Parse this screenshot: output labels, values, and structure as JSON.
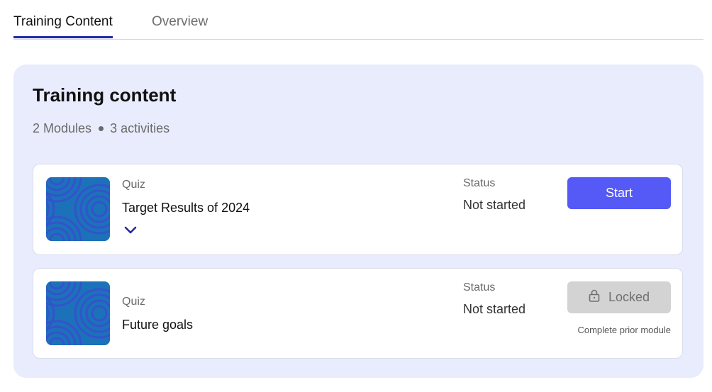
{
  "tabs": [
    {
      "label": "Training Content",
      "active": true
    },
    {
      "label": "Overview",
      "active": false
    }
  ],
  "panel": {
    "title": "Training content",
    "modules": "2 Modules",
    "activities": "3 activities"
  },
  "items": [
    {
      "type": "Quiz",
      "title": "Target Results of 2024",
      "status_caption": "Status",
      "status": "Not started",
      "action_label": "Start",
      "expand_icon": "chevron-down-icon"
    },
    {
      "type": "Quiz",
      "title": "Future goals",
      "status_caption": "Status",
      "status": "Not started",
      "action_label": "Locked",
      "action_icon": "lock-icon",
      "hint": "Complete prior module"
    }
  ],
  "colors": {
    "accent": "#5559f5",
    "tab_underline": "#1f2aa8",
    "panel_bg": "#e8ecfc",
    "locked_bg": "#d3d3d3"
  }
}
